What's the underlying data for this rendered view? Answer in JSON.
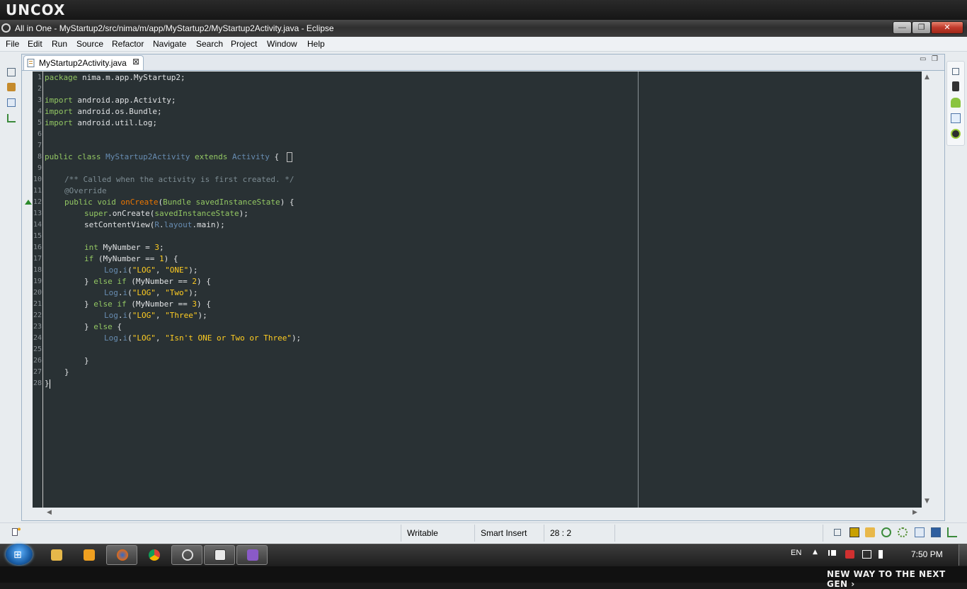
{
  "brand": {
    "logo": "UNCOX",
    "tagline": "NEW WAY TO THE NEXT GEN ›"
  },
  "window": {
    "title": "All in One - MyStartup2/src/nima/m/app/MyStartup2/MyStartup2Activity.java - Eclipse",
    "controls": {
      "minimize": "—",
      "maximize": "❐",
      "close": "✕"
    }
  },
  "menu": [
    "File",
    "Edit",
    "Run",
    "Source",
    "Refactor",
    "Navigate",
    "Search",
    "Project",
    "Window",
    "Help"
  ],
  "editor": {
    "tab": {
      "label": "MyStartup2Activity.java",
      "close": "⊠"
    },
    "pane_controls": {
      "minimize": "▭",
      "maximize": "❐"
    },
    "line_numbers": [
      "1",
      "2",
      "3",
      "4",
      "5",
      "6",
      "7",
      "8",
      "9",
      "10",
      "11",
      "12",
      "13",
      "14",
      "15",
      "16",
      "17",
      "18",
      "19",
      "20",
      "21",
      "22",
      "23",
      "24",
      "25",
      "26",
      "27",
      "28"
    ],
    "code": {
      "l1_kw": "package",
      "l1_rest": " nima.m.app.MyStartup2;",
      "l3_kw": "import",
      "l3_rest": " android.app.Activity;",
      "l4_kw": "import",
      "l4_rest": " android.os.Bundle;",
      "l5_kw": "import",
      "l5_rest": " android.util.Log;",
      "l8_kw1": "public class",
      "l8_cls": "MyStartup2Activity",
      "l8_kw2": "extends",
      "l8_sup": "Activity",
      "l8_brace": "{",
      "l10": "/** Called when the activity is first created. */",
      "l11": "@Override",
      "l12_kw": "public void",
      "l12_mt": "onCreate",
      "l12_p1": "(",
      "l12_ty": "Bundle",
      "l12_arg": "savedInstanceState",
      "l12_end": ") {",
      "l13_kw": "super",
      "l13_rest": ".onCreate(",
      "l13_arg": "savedInstanceState",
      "l13_end": ");",
      "l14_mt": "setContentView(",
      "l14_r": "R",
      "l14_dot": ".",
      "l14_fld": "layout",
      "l14_end": ".main);",
      "l16_kw": "int",
      "l16_rest": " MyNumber = ",
      "l16_num": "3",
      "l16_end": ";",
      "l17_kw": "if",
      "l17_rest": " (MyNumber == ",
      "l17_num": "1",
      "l17_end": ") {",
      "l18_cls": "Log",
      "l18_dot": ".",
      "l18_mt": "i",
      "l18_p": "(",
      "l18_s1": "\"LOG\"",
      "l18_c": ", ",
      "l18_s2": "\"ONE\"",
      "l18_end": ");",
      "l19_b": "} ",
      "l19_kw": "else if",
      "l19_rest": " (MyNumber == ",
      "l19_num": "2",
      "l19_end": ") {",
      "l20_cls": "Log",
      "l20_dot": ".",
      "l20_mt": "i",
      "l20_p": "(",
      "l20_s1": "\"LOG\"",
      "l20_c": ", ",
      "l20_s2": "\"Two\"",
      "l20_end": ");",
      "l21_b": "} ",
      "l21_kw": "else if",
      "l21_rest": " (MyNumber == ",
      "l21_num": "3",
      "l21_end": ") {",
      "l22_cls": "Log",
      "l22_dot": ".",
      "l22_mt": "i",
      "l22_p": "(",
      "l22_s1": "\"LOG\"",
      "l22_c": ", ",
      "l22_s2": "\"Three\"",
      "l22_end": ");",
      "l23_b": "} ",
      "l23_kw": "else",
      "l23_end": " {",
      "l24_cls": "Log",
      "l24_dot": ".",
      "l24_mt": "i",
      "l24_p": "(",
      "l24_s1": "\"LOG\"",
      "l24_c": ", ",
      "l24_s2": "\"Isn't ONE or Two or Three\"",
      "l24_end": ");",
      "l26": "}",
      "l27": "}",
      "l28": "}"
    }
  },
  "status": {
    "mode": "Writable",
    "insert": "Smart Insert",
    "position": "28 : 2"
  },
  "taskbar": {
    "language": "EN",
    "tray_arrow": "▲",
    "clock": "7:50 PM",
    "start_flag": "⊞"
  },
  "colors": {
    "editor_bg": "#293134",
    "keyword": "#93c763",
    "type": "#678cb1",
    "string": "#ec7600",
    "comment": "#7d8c93",
    "annotation": "#a082bd",
    "number": "#ffcd22",
    "accent_close": "#c0392b"
  }
}
